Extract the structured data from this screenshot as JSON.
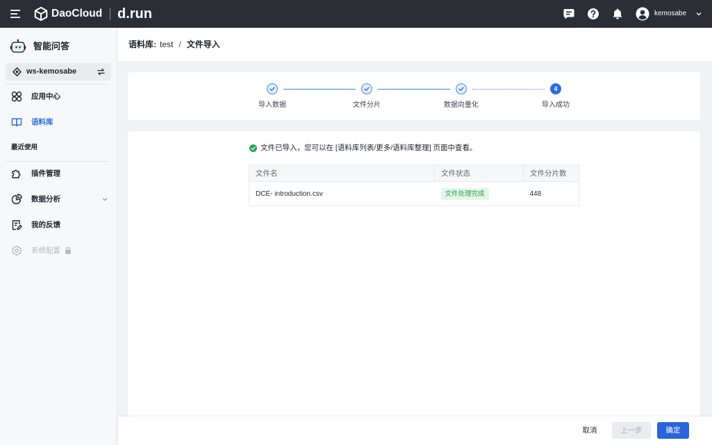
{
  "topbar": {
    "brand": "DaoCloud",
    "product": "d.run",
    "username": "kemosabe",
    "icons": [
      "menu-icon",
      "daocloud-logo-icon",
      "message-icon",
      "help-icon",
      "bell-icon",
      "user-avatar-icon",
      "chevron-down-icon"
    ]
  },
  "sidebar": {
    "app_title": "智能问答",
    "app_icon": "robot-icon",
    "workspace": "ws-kemosabe",
    "workspace_icons": [
      "workspace-diamond-icon",
      "switch-icon"
    ],
    "nav": [
      {
        "label": "应用中心",
        "icon": "app-grid-icon",
        "active": false
      },
      {
        "label": "语料库",
        "icon": "book-icon",
        "active": true
      }
    ],
    "recent_title": "最近使用",
    "recent": [
      {
        "label": "插件管理",
        "icon": "puzzle-icon"
      },
      {
        "label": "数据分析",
        "icon": "pie-chart-icon",
        "expandable": true
      },
      {
        "label": "我的反馈",
        "icon": "feedback-icon"
      },
      {
        "label": "系统配置",
        "icon": "settings-icon",
        "disabled": true,
        "locked": true
      }
    ]
  },
  "breadcrumb": {
    "section": "语料库:",
    "corpus": "test",
    "separator": "/",
    "current": "文件导入"
  },
  "steps": [
    {
      "label": "导入数据",
      "completed": true
    },
    {
      "label": "文件分片",
      "completed": true
    },
    {
      "label": "数据向量化",
      "completed": true
    },
    {
      "label": "导入成功",
      "completed": false,
      "current": true,
      "number": "4"
    }
  ],
  "result": {
    "icon": "success-check-icon",
    "message": "文件已导入，您可以在 [语料库列表/更多/语料库整理] 页面中查看。",
    "table": {
      "columns": [
        "文件名",
        "文件状态",
        "文件分片数"
      ],
      "rows": [
        {
          "file_name": "DCE- introduction.csv",
          "status": "文件处理完成",
          "chunks": "448"
        }
      ]
    }
  },
  "footer": {
    "cancel": "取消",
    "previous": "上一步",
    "previous_disabled": true,
    "confirm": "确定"
  },
  "colors": {
    "topbar_bg": "#2b2e34",
    "primary": "#2a64db",
    "active_nav": "#2d6ae3",
    "step_line": "#3a82f0",
    "success": "#25a551",
    "success_badge_bg": "#e4f6e9",
    "success_badge_text": "#2a9d4a",
    "page_bg": "#f0f2f5",
    "sidebar_bg": "#f7f8fa",
    "disabled_button_bg": "#e8ebf0"
  }
}
